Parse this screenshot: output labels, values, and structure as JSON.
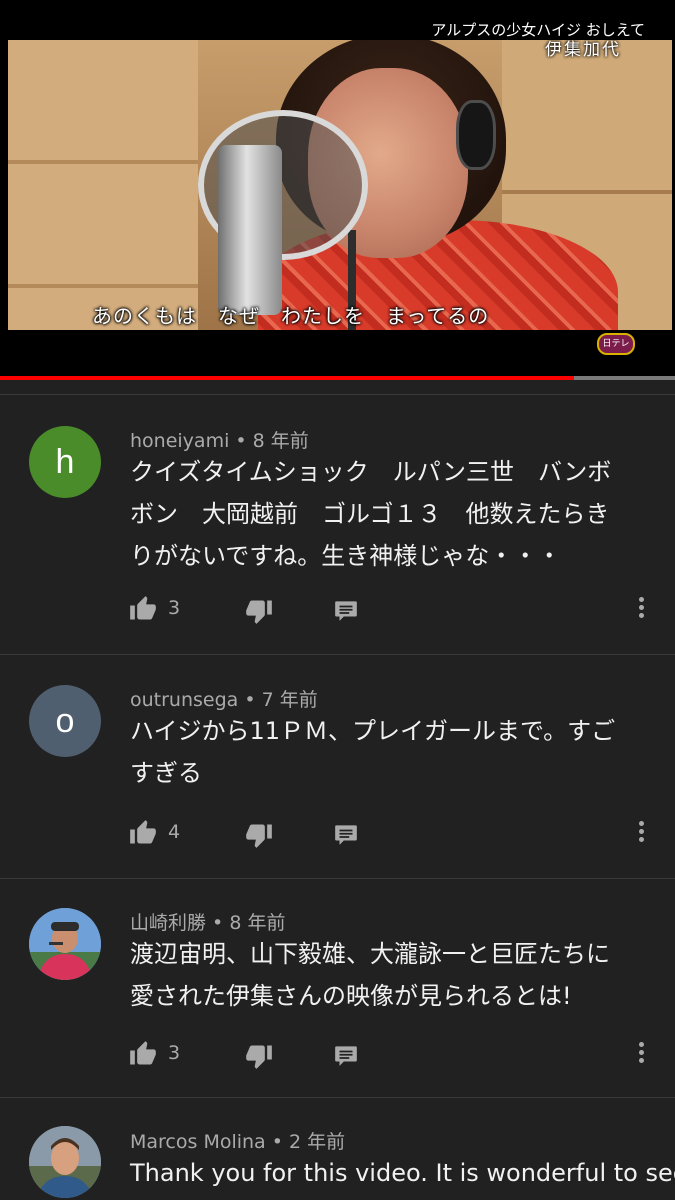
{
  "video": {
    "caption_top_line1": "アルプスの少女ハイジ おしえて",
    "caption_top_line2": "伊集加代",
    "subtitle": "あのくもは　なぜ　わたしを　まってるの",
    "channel_logo": "日テレ",
    "progress_fraction": 0.85,
    "progress_color": "#ff0000"
  },
  "comments": [
    {
      "author": "honeiyami",
      "age": "8 年前",
      "avatar_letter": "h",
      "avatar_color": "#4a8c2a",
      "lines": [
        "クイズタイムショック　ルパン三世　バンボ",
        "ボン　大岡越前　ゴルゴ１３　他数えたらき",
        "りがないですね。生き神様じゃな・・・"
      ],
      "likes": "3"
    },
    {
      "author": "outrunsega",
      "age": "7 年前",
      "avatar_letter": "o",
      "avatar_color": "#4f5f70",
      "lines": [
        "ハイジから11ＰＭ、プレイガールまで。すご",
        "すぎる"
      ],
      "likes": "4"
    },
    {
      "author": "山崎利勝",
      "age": "8 年前",
      "avatar_letter": "",
      "avatar_color": "#5a86b8",
      "lines": [
        "渡辺宙明、山下毅雄、大瀧詠一と巨匠たちに",
        "愛された伊集さんの映像が見られるとは!"
      ],
      "likes": "3"
    },
    {
      "author": "Marcos Molina",
      "age": "2 年前",
      "avatar_letter": "",
      "avatar_color": "#6b7d8e",
      "lines": [
        "Thank you for this video. It is wonderful to see"
      ],
      "likes": ""
    }
  ],
  "icons": {
    "like": "thumb-up-icon",
    "dislike": "thumb-down-icon",
    "reply": "comment-reply-icon",
    "more": "more-vertical-icon"
  }
}
